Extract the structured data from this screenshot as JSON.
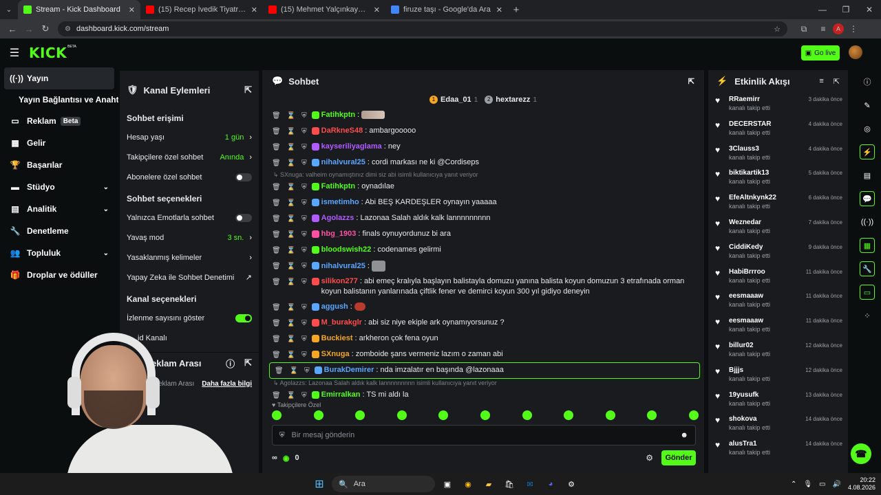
{
  "browser": {
    "tabs": [
      {
        "title": "Stream - Kick Dashboard",
        "color": "#53fc18",
        "active": true
      },
      {
        "title": "(15) Recep İvedik Tiyatroda. #re",
        "color": "#ff0000",
        "active": false
      },
      {
        "title": "(15) Mehmet Yalçınkaya'nın Mu",
        "color": "#ff0000",
        "active": false
      },
      {
        "title": "firuze taşı - Google'da Ara",
        "color": "#4285f4",
        "active": false
      }
    ],
    "url": "dashboard.kick.com/stream",
    "profile_initial": "A"
  },
  "kick": {
    "logo": "KICK",
    "beta": "BETA",
    "go_live": "Go live",
    "accent": "#53fc18"
  },
  "leftnav": {
    "items": [
      {
        "label": "Yayın",
        "icon": "broadcast-icon"
      },
      {
        "label": "Yayın Bağlantısı ve Anahtarı"
      },
      {
        "label": "Reklam",
        "badge": "Beta",
        "icon": "ad-icon"
      },
      {
        "label": "Gelir",
        "icon": "revenue-icon"
      },
      {
        "label": "Başarılar",
        "icon": "trophy-icon"
      },
      {
        "label": "Stüdyo",
        "icon": "studio-icon"
      },
      {
        "label": "Analitik",
        "icon": "analytics-icon"
      },
      {
        "label": "Denetleme",
        "icon": "wrench-icon"
      },
      {
        "label": "Topluluk",
        "icon": "community-icon"
      },
      {
        "label": "Droplar ve ödüller",
        "icon": "gift-icon"
      }
    ]
  },
  "kanal": {
    "title": "Kanal Eylemleri",
    "sohbet_erisimi": "Sohbet erişimi",
    "hesap_yasi": "Hesap yaşı",
    "hesap_yasi_val": "1 gün",
    "takipci_ozel": "Takipçilere özel sohbet",
    "takipci_ozel_val": "Anında",
    "abone_ozel": "Abonelere özel sohbet",
    "sohbet_secenekleri": "Sohbet seçenekleri",
    "emote_only": "Yalnızca Emotlarla sohbet",
    "yavas_mod": "Yavaş mod",
    "yavas_mod_val": "3 sn.",
    "yasakli": "Yasaklanmış kelimeler",
    "yapay_zeka": "Yapay Zeka ile Sohbet Denetimi",
    "kanal_secenekleri": "Kanal seçenekleri",
    "izlenme": "İzlenme sayısını göster",
    "id_kanali": "id Kanalı",
    "reklam_title": "eklam Arası",
    "reklam_sub": "eklam Arası",
    "daha_fazla": "Daha fazla bilgi"
  },
  "chat": {
    "title": "Sohbet",
    "pinned": [
      {
        "name": "Edaa_01",
        "count": "1",
        "coin": "1"
      },
      {
        "name": "hextarezz",
        "count": "1",
        "coin": "2"
      }
    ],
    "messages": [
      {
        "user": "Fatihkptn",
        "color": "#53fc18",
        "text": "",
        "emote": "rect"
      },
      {
        "user": "DaRkneS48",
        "color": "#ff4c4c",
        "text": "ambargooooo"
      },
      {
        "user": "kayseriliyaglama",
        "color": "#b15cff",
        "text": "ney"
      },
      {
        "user": "nihalvural25",
        "color": "#5aa7ff",
        "text": "cordi markası ne ki @Cordiseps"
      },
      {
        "user": "Fatihkptn",
        "color": "#53fc18",
        "text": "oynadılae",
        "reply": "SXnuga: valheim oynamıştınız dimi siz abi isimli kullanıcıya yanıt veriyor"
      },
      {
        "user": "ismetimho",
        "color": "#5aa7ff",
        "text": "Abi BEŞ KARDEŞLER oynayın yaaaaa"
      },
      {
        "user": "Agolazzs",
        "color": "#b15cff",
        "text": "Lazonaa Salah aldık kalk lannnnnnnnn"
      },
      {
        "user": "hbg_1903",
        "color": "#ff4fa3",
        "text": "finals oynuyordunuz bi ara"
      },
      {
        "user": "bloodswish22",
        "color": "#53fc18",
        "text": "codenames gelirmi"
      },
      {
        "user": "nihalvural25",
        "color": "#5aa7ff",
        "text": "",
        "emote": "cat"
      },
      {
        "user": "silikon277",
        "color": "#ff4c4c",
        "text": "abi emeç kralıyla başlayın balistayla domuzu yanına balista koyun domuzun 3 etrafınada orman koyun balistanın yanlarınada çiftlik fener ve demirci koyun 300 yıl gidiyo deneyin"
      },
      {
        "user": "aggush",
        "color": "#5aa7ff",
        "text": "",
        "emote": "red"
      },
      {
        "user": "M_burakglr",
        "color": "#ff4c4c",
        "text": "abi siz niye ekiple ark oynamıyorsunuz ?"
      },
      {
        "user": "Buckiest",
        "color": "#f5a623",
        "text": "arkheron çok fena oyun"
      },
      {
        "user": "SXnuga",
        "color": "#f5a623",
        "text": "zomboide şans vermeniz lazım o zaman abi"
      },
      {
        "user": "BurakDemirer",
        "color": "#5aa7ff",
        "text": "nda imzalatır en başında @lazonaaa",
        "highlight": true
      },
      {
        "user": "Emirralkan",
        "color": "#53fc18",
        "text": "TS mi aldı la",
        "reply": "Agolazzs: Lazonaa Salah aldık kalk lannnnnnnnn isimli kullanıcıya yanıt veriyor"
      }
    ],
    "followers_only": "Takipçilere Özel",
    "input_placeholder": "Bir mesaj gönderin",
    "points": "0",
    "send": "Gönder"
  },
  "feed": {
    "title": "Etkinlik Akışı",
    "items": [
      {
        "name": "RRaemirr",
        "sub": "kanalı takip etti",
        "time": "3 dakika önce"
      },
      {
        "name": "DECERSTAR",
        "sub": "kanalı takip etti",
        "time": "4 dakika önce"
      },
      {
        "name": "3Clauss3",
        "sub": "kanalı takip etti",
        "time": "4 dakika önce"
      },
      {
        "name": "biktikartik13",
        "sub": "kanalı takip etti",
        "time": "5 dakika önce"
      },
      {
        "name": "EfeAltnkynk22",
        "sub": "kanalı takip etti",
        "time": "6 dakika önce"
      },
      {
        "name": "Weznedar",
        "sub": "kanalı takip etti",
        "time": "7 dakika önce"
      },
      {
        "name": "CiddiKedy",
        "sub": "kanalı takip etti",
        "time": "9 dakika önce"
      },
      {
        "name": "HabiBrrroo",
        "sub": "kanalı takip etti",
        "time": "11 dakika önce"
      },
      {
        "name": "eesmaaaw",
        "sub": "kanalı takip etti",
        "time": "11 dakika önce"
      },
      {
        "name": "eesmaaaw",
        "sub": "kanalı takip etti",
        "time": "11 dakika önce"
      },
      {
        "name": "billur02",
        "sub": "kanalı takip etti",
        "time": "12 dakika önce"
      },
      {
        "name": "Bjjjs",
        "sub": "kanalı takip etti",
        "time": "12 dakika önce"
      },
      {
        "name": "19yusufk",
        "sub": "kanalı takip etti",
        "time": "13 dakika önce"
      },
      {
        "name": "shokova",
        "sub": "kanalı takip etti",
        "time": "14 dakika önce"
      },
      {
        "name": "alusTra1",
        "sub": "kanalı takip etti",
        "time": "14 dakika önce"
      }
    ]
  },
  "taskbar": {
    "search": "Ara",
    "time": "20:22",
    "date": "4.08.2026"
  }
}
